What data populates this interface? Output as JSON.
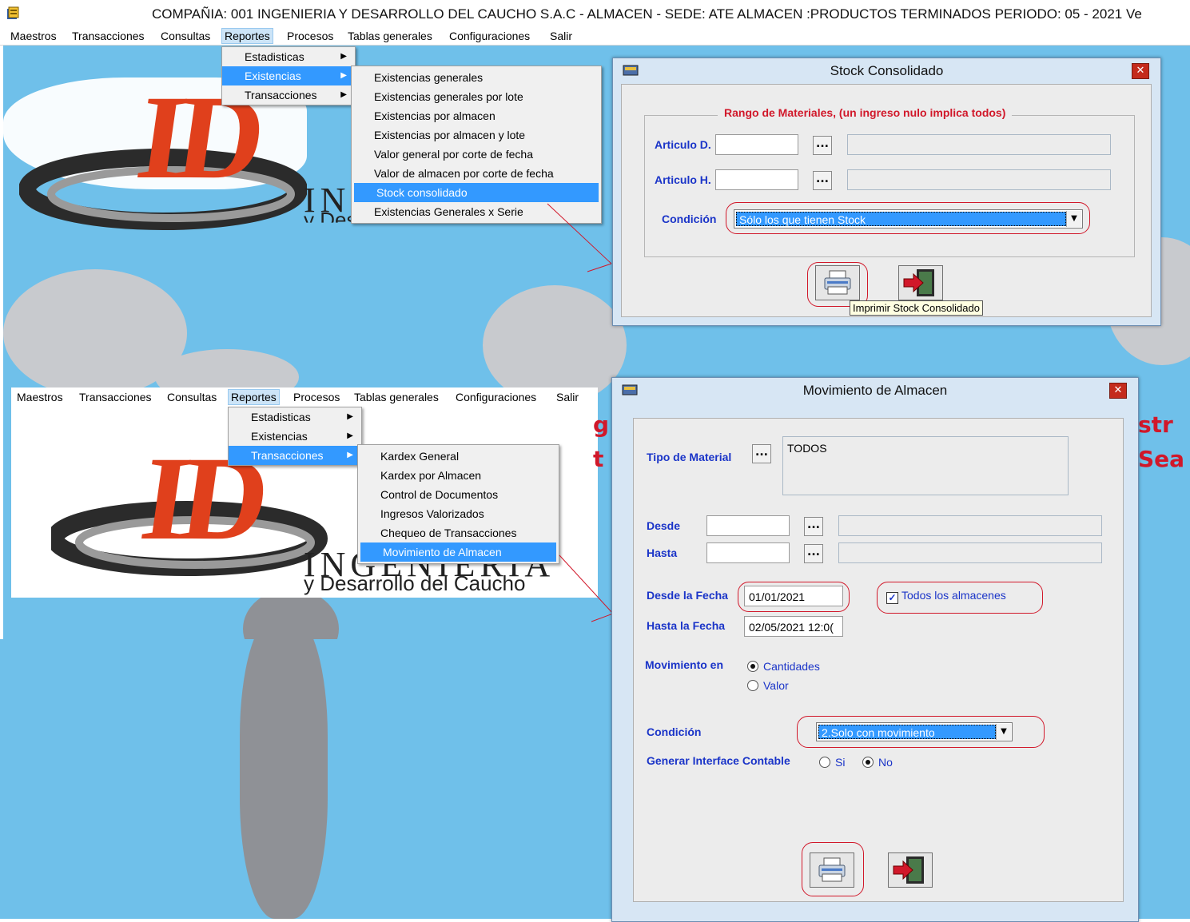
{
  "window": {
    "title": "COMPAÑIA: 001 INGENIERIA Y DESARROLLO DEL CAUCHO S.A.C  - ALMACEN -  SEDE: ATE  ALMACEN :PRODUCTOS TERMINADOS  PERIODO: 05 - 2021     Ve"
  },
  "menubar": [
    "Maestros",
    "Transacciones",
    "Consultas",
    "Reportes",
    "Procesos",
    "Tablas generales",
    "Configuraciones",
    "Salir"
  ],
  "logo": {
    "mark": "ID",
    "name_visible_top": "IN",
    "name_visible_bottom": "INGENIERIA",
    "subtitle_top": "y Desarrollo del Caucho",
    "subtitle_bottom": "y Desarrollo del Caucho",
    "colors": {
      "mark": "#e0401c",
      "background_map": "#6fc0ea"
    }
  },
  "background_fragments": {
    "right_text_1": "g",
    "right_text_2": "t",
    "right_text_3": "str",
    "right_text_4": "Sea"
  },
  "reportes_menu": {
    "items": [
      "Estadisticas",
      "Existencias",
      "Transacciones"
    ]
  },
  "existencias_submenu": {
    "items": [
      "Existencias generales",
      "Existencias generales por lote",
      "Existencias por almacen",
      "Existencias por almacen y lote",
      "Valor general por corte de fecha",
      "Valor de almacen por corte de fecha",
      "Stock consolidado",
      "Existencias Generales x Serie"
    ],
    "selected": "Stock consolidado"
  },
  "transacciones_submenu": {
    "items": [
      "Kardex General",
      "Kardex por Almacen",
      "Control de Documentos",
      "Ingresos Valorizados",
      "Chequeo de Transacciones",
      "Movimiento de Almacen"
    ],
    "selected": "Movimiento de Almacen"
  },
  "stock_dialog": {
    "title": "Stock Consolidado",
    "close_label": "✕",
    "group_title": "Rango de Materiales, (un ingreso nulo implica todos)",
    "articulo_d_label": "Articulo D.",
    "articulo_h_label": "Articulo H.",
    "articulo_d_value": "",
    "articulo_h_value": "",
    "dots_label": "...",
    "condicion_label": "Condición",
    "condicion_value": "Sólo los que tienen Stock",
    "tooltip": "Imprimir Stock Consolidado"
  },
  "mov_dialog": {
    "title": "Movimiento de Almacen",
    "close_label": "✕",
    "tipo_material_label": "Tipo de Material",
    "tipo_material_value": "TODOS",
    "desde_label": "Desde",
    "hasta_label": "Hasta",
    "desde_fecha_label": "Desde la Fecha",
    "desde_fecha_value": "01/01/2021",
    "hasta_fecha_label": "Hasta la Fecha",
    "hasta_fecha_value": "02/05/2021 12:0(",
    "todos_almacenes_label": "Todos los almacenes",
    "todos_almacenes_checked": true,
    "movimiento_en_label": "Movimiento en",
    "opt_cantidades": "Cantidades",
    "opt_valor": "Valor",
    "movimiento_en_selected": "Cantidades",
    "condicion_label": "Condición",
    "condicion_value": "2.Solo con movimiento",
    "interface_label": "Generar Interface Contable",
    "opt_si": "Si",
    "opt_no": "No",
    "interface_selected": "No",
    "dots_label": "..."
  },
  "icons": {
    "app": "app-icon",
    "print": "printer-icon",
    "exit": "exit-door-icon",
    "dialog": "dialog-app-icon",
    "submenu": "chevron-right-icon",
    "dropdown": "chevron-down-icon"
  },
  "colors": {
    "label_blue": "#1a34c8",
    "highlight_red": "#d1182a",
    "selection_blue": "#3399ff",
    "dialog_frame": "#d7e6f4"
  }
}
